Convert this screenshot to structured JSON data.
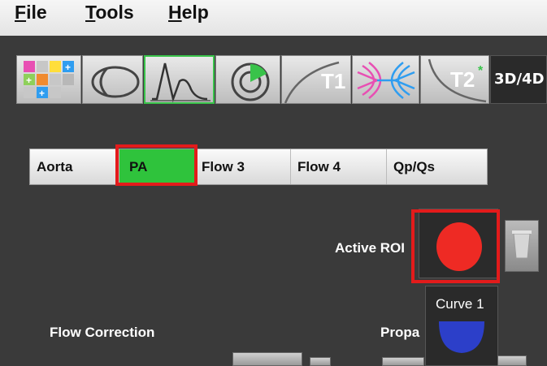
{
  "menu": {
    "file_first": "F",
    "file_rest": "ile",
    "tools_first": "T",
    "tools_rest": "ools",
    "help_first": "H",
    "help_rest": "elp"
  },
  "toolbar": {
    "t1_label": "T1",
    "t2_label": "T2",
    "t2_star": "*",
    "btn_3d4d_label": "3D/4D"
  },
  "tabs": [
    {
      "label": "Aorta"
    },
    {
      "label": "PA"
    },
    {
      "label": "Flow 3"
    },
    {
      "label": "Flow 4"
    },
    {
      "label": "Qp/Qs"
    }
  ],
  "active_roi_label": "Active ROI",
  "curve_label": "Curve 1",
  "flow_correction_label": "Flow Correction",
  "propagate_label": "Propa",
  "colors": {
    "active_tab": "#2fc33c",
    "highlight": "#e31b1b",
    "roi_red": "#ee2a24",
    "roi_blue": "#2c3fc9"
  }
}
